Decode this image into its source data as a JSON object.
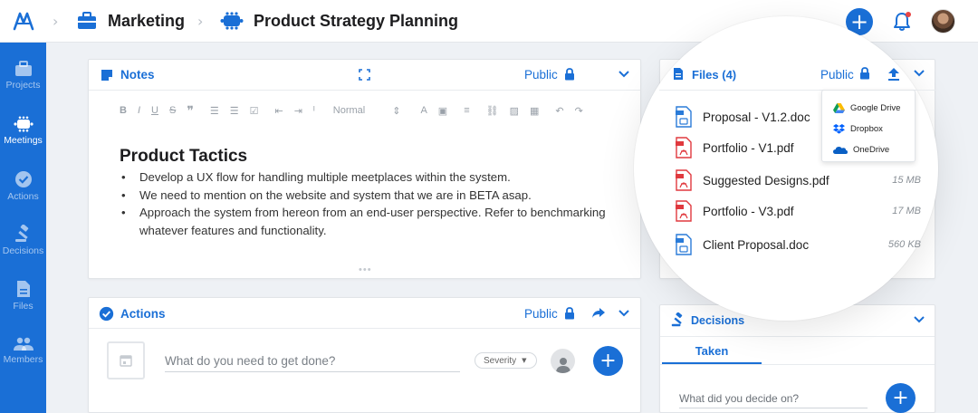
{
  "header": {
    "workspace": "Marketing",
    "meeting": "Product Strategy Planning"
  },
  "sidebar": {
    "items": [
      {
        "label": "Projects",
        "icon": "briefcase-icon",
        "active": false
      },
      {
        "label": "Meetings",
        "icon": "meeting-icon",
        "active": true
      },
      {
        "label": "Actions",
        "icon": "check-circle-icon",
        "active": false
      },
      {
        "label": "Decisions",
        "icon": "gavel-icon",
        "active": false
      },
      {
        "label": "Files",
        "icon": "file-icon",
        "active": false
      },
      {
        "label": "Members",
        "icon": "people-icon",
        "active": false
      }
    ]
  },
  "notes": {
    "title": "Notes",
    "visibility": "Public",
    "toolbar": {
      "style_select": "Normal"
    },
    "doc_title": "Product Tactics",
    "bullets": [
      "Develop a UX flow for handling multiple meetplaces within the system.",
      "We need to mention on the website and system that we are in BETA asap.",
      "Approach the system from hereon from an end-user perspective. Refer to benchmarking whatever features and functionality."
    ]
  },
  "actions": {
    "title": "Actions",
    "visibility": "Public",
    "input_placeholder": "What do you need to get done?",
    "severity_label": "Severity"
  },
  "files": {
    "title": "Files (4)",
    "visibility": "Public",
    "items": [
      {
        "name": "Proposal - V1.2.doc",
        "size": "",
        "type": "doc"
      },
      {
        "name": "Portfolio - V1.pdf",
        "size": "",
        "type": "pdf"
      },
      {
        "name": "Suggested Designs.pdf",
        "size": "15 MB",
        "type": "pdf"
      },
      {
        "name": "Portfolio - V3.pdf",
        "size": "17 MB",
        "type": "pdf"
      },
      {
        "name": "Client Proposal.doc",
        "size": "560 KB",
        "type": "doc"
      }
    ],
    "upload_menu": [
      {
        "label": "Google Drive",
        "icon": "google-drive-icon"
      },
      {
        "label": "Dropbox",
        "icon": "dropbox-icon"
      },
      {
        "label": "OneDrive",
        "icon": "onedrive-icon"
      }
    ]
  },
  "decisions": {
    "title": "Decisions",
    "tab_taken": "Taken",
    "input_placeholder": "What did you decide on?"
  },
  "colors": {
    "primary": "#1a6fd6",
    "pdf": "#e0393e",
    "doc": "#2a7bd8"
  }
}
